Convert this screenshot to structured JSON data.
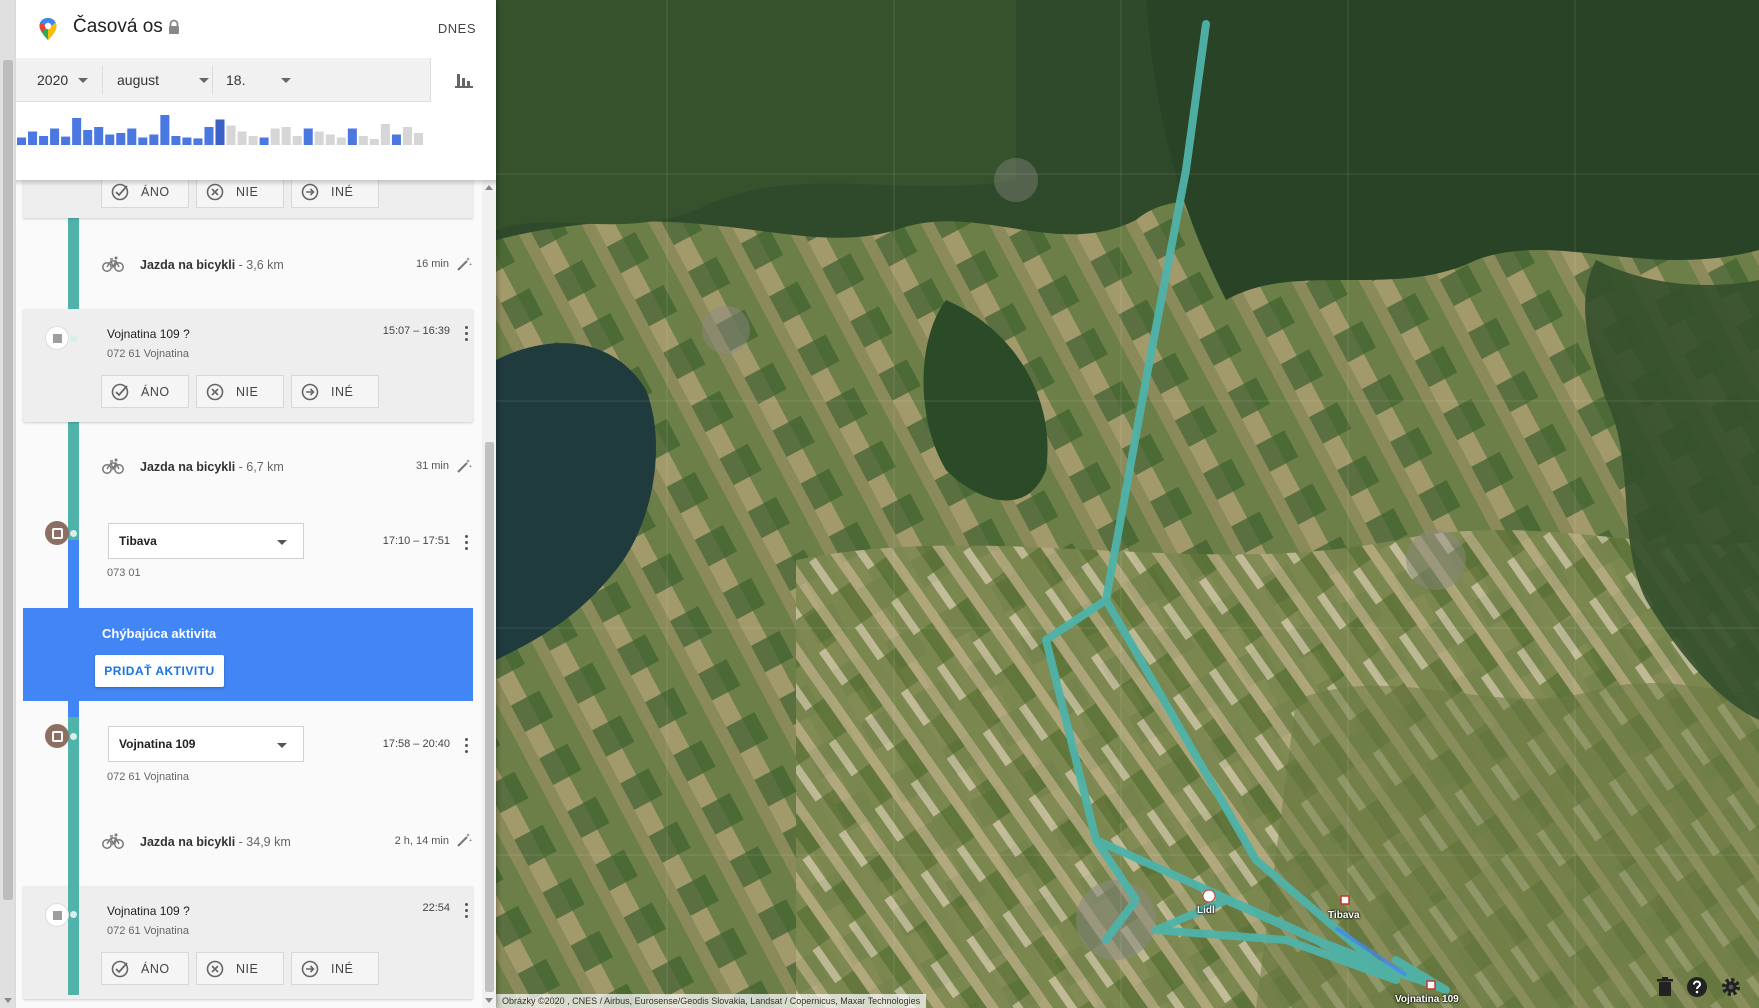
{
  "header": {
    "title": "Časová os",
    "today_label": "DNES"
  },
  "date": {
    "year": "2020",
    "month": "august",
    "day": "18."
  },
  "histogram": {
    "values": [
      0.25,
      0.45,
      0.3,
      0.55,
      0.28,
      0.9,
      0.5,
      0.6,
      0.35,
      0.4,
      0.55,
      0.25,
      0.35,
      1.0,
      0.3,
      0.25,
      0.22,
      0.6,
      0.85,
      0.65,
      0.45,
      0.3,
      0.25,
      0.55,
      0.6,
      0.3,
      0.55,
      0.45,
      0.35,
      0.25,
      0.55,
      0.3,
      0.2,
      0.7,
      0.35,
      0.6,
      0.4
    ],
    "highlight_index": 18
  },
  "timeline": {
    "answer_labels": {
      "yes": "ÁNO",
      "no": "NIE",
      "other": "INÉ"
    },
    "activities": [
      {
        "name": "Jazda na bicykli",
        "distance": "- 3,6 km",
        "duration": "16 min"
      },
      {
        "name": "Jazda na bicykli",
        "distance": "- 6,7 km",
        "duration": "31 min"
      },
      {
        "name": "Jazda na bicykli",
        "distance": "- 34,9 km",
        "duration": "2 h, 14 min"
      }
    ],
    "places": [
      {
        "name": "Vojnatina 109 ?",
        "address": "072 61 Vojnatina",
        "time": "15:07 – 16:39"
      },
      {
        "name": "Tibava",
        "address": "073 01",
        "time": "17:10 – 17:51"
      },
      {
        "name": "Vojnatina 109",
        "address": "072 61 Vojnatina",
        "time": "17:58 – 20:40"
      },
      {
        "name": "Vojnatina 109 ?",
        "address": "072 61 Vojnatina",
        "time": "22:54"
      }
    ],
    "missing": {
      "title": "Chýbajúca aktivita",
      "button": "PRIDAŤ AKTIVITU"
    }
  },
  "map": {
    "labels": {
      "lidl": "Lidl",
      "tibava": "Tibava",
      "vojnatina": "Vojnatina 109"
    },
    "attribution": "Obrázky ©2020 , CNES / Airbus, Eurosense/Geodis Slovakia, Landsat / Copernicus, Maxar Technologies",
    "route_color": "#4fb3a9"
  },
  "colors": {
    "accent": "#4285f4",
    "route": "#4fb3a9",
    "place_brown": "#8d6e63"
  }
}
